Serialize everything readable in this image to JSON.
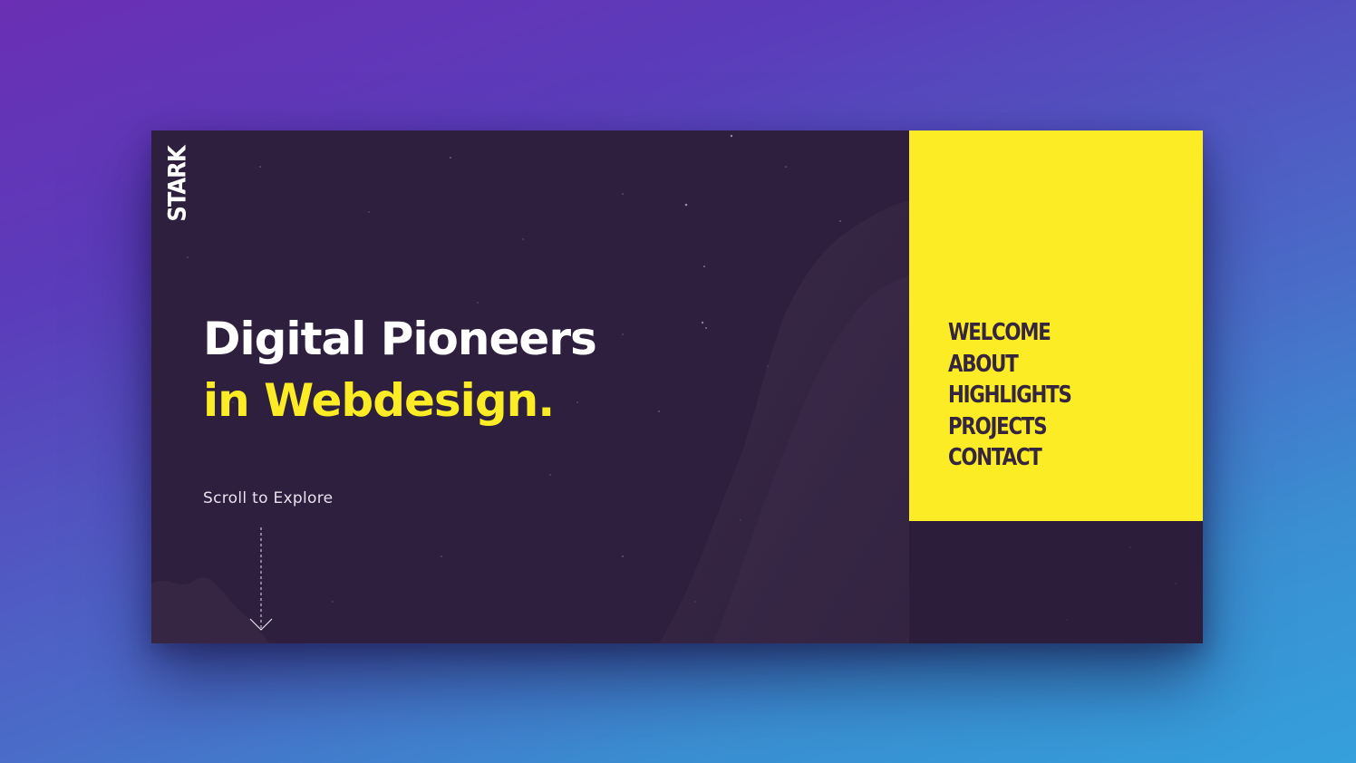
{
  "brand": {
    "logo_text": "STARK"
  },
  "hero": {
    "headline_line1": "Digital Pioneers",
    "headline_line2": "in Webdesign.",
    "scroll_label": "Scroll to Explore"
  },
  "menu": {
    "items": [
      {
        "label": "WELCOME"
      },
      {
        "label": "ABOUT"
      },
      {
        "label": "HIGHLIGHTS"
      },
      {
        "label": "PROJECTS"
      },
      {
        "label": "CONTACT"
      }
    ]
  },
  "colors": {
    "accent_yellow": "#fbec26",
    "card_background": "#2e1f3e",
    "menu_text": "#35253f",
    "background_top": "#6a2fb4",
    "background_bottom": "#35a0dc"
  },
  "icons": {
    "scroll": "arrow-down-icon"
  }
}
